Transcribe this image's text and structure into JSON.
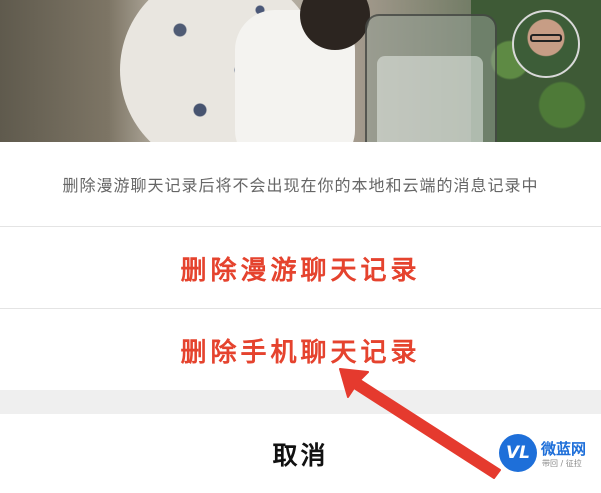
{
  "background": {
    "description_colors": {
      "sheet": "#ffffff",
      "separator": "#e4e4e4",
      "gap": "#efefef"
    }
  },
  "sheet": {
    "info": "删除漫游聊天记录后将不会出现在你的本地和云端的消息记录中",
    "delete_roaming": "删除漫游聊天记录",
    "delete_phone": "删除手机聊天记录",
    "cancel": "取消"
  },
  "colors": {
    "destructive": "#e5432e",
    "info_text": "#666666",
    "cancel_text": "#111111",
    "arrow": "#e53a2e"
  },
  "watermark": {
    "logo": "VL",
    "name": "微蓝网",
    "sub": "带回 / 征拉"
  },
  "icons": [
    "avatar",
    "annotation-arrow-icon",
    "watermark-logo-icon"
  ]
}
